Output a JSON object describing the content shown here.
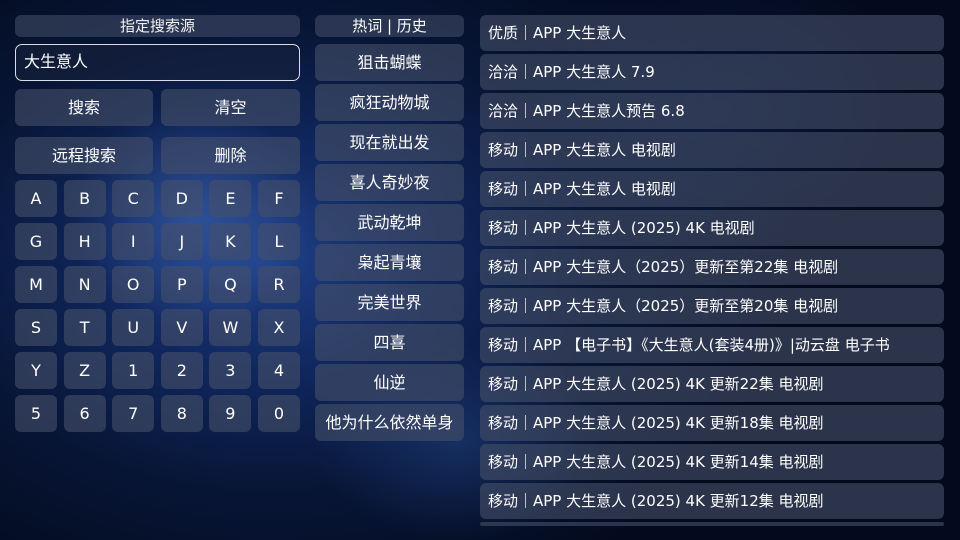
{
  "left": {
    "header": "指定搜索源",
    "search_value": "大生意人",
    "buttons": {
      "search": "搜索",
      "clear": "清空",
      "remote_search": "远程搜索",
      "delete": "删除"
    },
    "keys": [
      "A",
      "B",
      "C",
      "D",
      "E",
      "F",
      "G",
      "H",
      "I",
      "J",
      "K",
      "L",
      "M",
      "N",
      "O",
      "P",
      "Q",
      "R",
      "S",
      "T",
      "U",
      "V",
      "W",
      "X",
      "Y",
      "Z",
      "1",
      "2",
      "3",
      "4",
      "5",
      "6",
      "7",
      "8",
      "9",
      "0"
    ]
  },
  "hot": {
    "header": "热词 | 历史",
    "items": [
      "狙击蝴蝶",
      "疯狂动物城",
      "现在就出发",
      "喜人奇妙夜",
      "武动乾坤",
      "枭起青壤",
      "完美世界",
      "四喜",
      "仙逆",
      "他为什么依然单身"
    ]
  },
  "results": [
    "优质｜APP  大生意人",
    "洽洽｜APP  大生意人  7.9",
    "洽洽｜APP  大生意人预告  6.8",
    "移动｜APP  大生意人  电视剧",
    "移动｜APP  大生意人  电视剧",
    "移动｜APP  大生意人 (2025) 4K  电视剧",
    "移动｜APP  大生意人（2025）更新至第22集  电视剧",
    "移动｜APP  大生意人（2025）更新至第20集  电视剧",
    "移动｜APP  【电子书】《大生意人(套装4册)》|动云盘  电子书",
    "移动｜APP  大生意人 (2025) 4K 更新22集  电视剧",
    "移动｜APP  大生意人 (2025) 4K 更新18集  电视剧",
    "移动｜APP  大生意人 (2025) 4K 更新14集  电视剧",
    "移动｜APP  大生意人 (2025) 4K 更新12集  电视剧"
  ]
}
